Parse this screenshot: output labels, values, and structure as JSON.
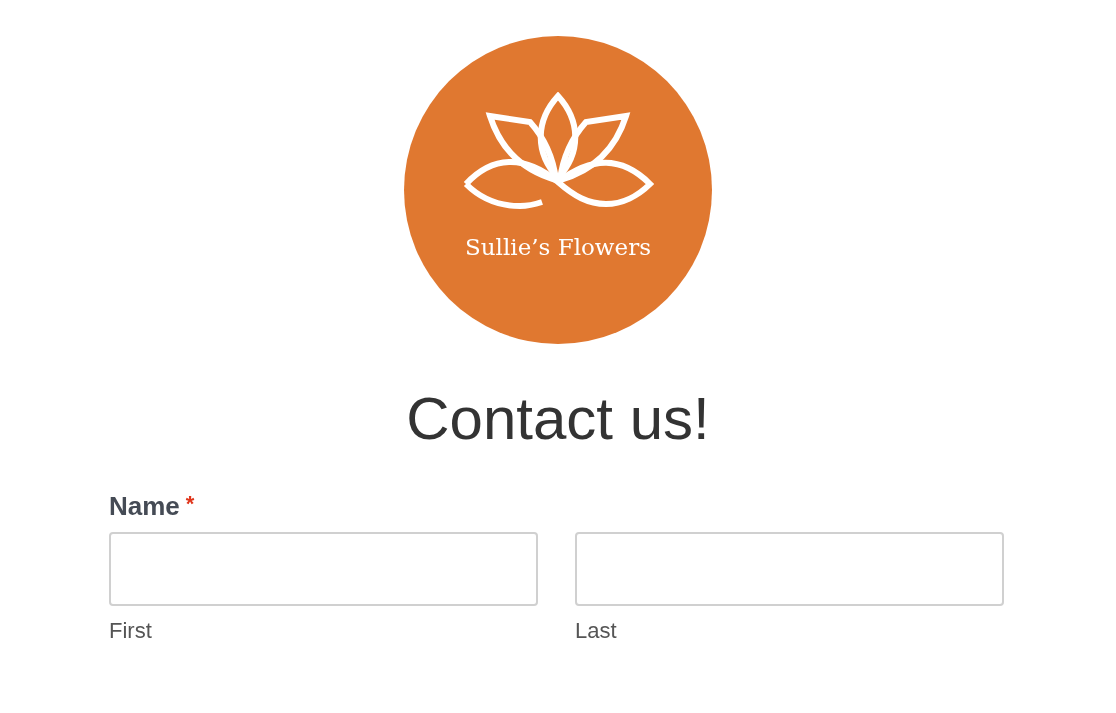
{
  "logo": {
    "text": "Sullie’s Flowers"
  },
  "title": "Contact us!",
  "fields": [
    {
      "label": "Name",
      "required": true,
      "required_mark": "*",
      "subfields": [
        {
          "label": "First"
        },
        {
          "label": "Last"
        }
      ]
    }
  ]
}
